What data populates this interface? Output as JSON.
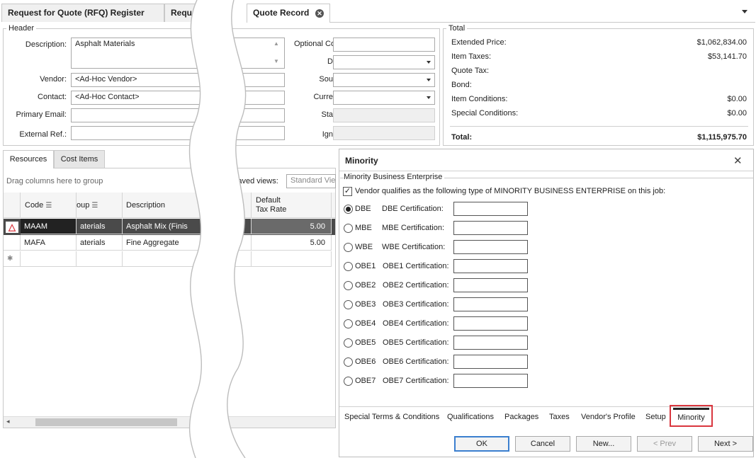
{
  "tabs": [
    {
      "label": "Request for Quote (RFQ) Register"
    },
    {
      "label": "Reque"
    },
    {
      "label": "Quote Record"
    }
  ],
  "header": {
    "section_title": "Header",
    "description_label": "Description:",
    "description_value": "Asphalt Materials",
    "vendor_label": "Vendor:",
    "vendor_value": "<Ad-Hoc Vendor>",
    "contact_label": "Contact:",
    "contact_value": "<Ad-Hoc Contact>",
    "email_label": "Primary Email:",
    "email_value": "",
    "extref_label": "External Ref.:",
    "extref_value": "",
    "optional_label": "Optional Co",
    "d_label": "D",
    "sou_label": "Sou",
    "curr_label": "Curre",
    "sta_label": "Sta",
    "ign_label": "Ign"
  },
  "totals": {
    "section_title": "Total",
    "rows": [
      {
        "label": "Extended Price:",
        "value": "$1,062,834.00"
      },
      {
        "label": "Item Taxes:",
        "value": "$53,141.70"
      },
      {
        "label": "Quote Tax:",
        "value": ""
      },
      {
        "label": "Bond:",
        "value": ""
      },
      {
        "label": "Item Conditions:",
        "value": "$0.00"
      },
      {
        "label": "Special Conditions:",
        "value": "$0.00"
      }
    ],
    "total_label": "Total:",
    "total_value": "$1,115,975.70"
  },
  "grid": {
    "tabs": [
      "Resources",
      "Cost Items"
    ],
    "group_hint": "Drag columns here to group",
    "saved_views_label": "Saved views:",
    "saved_views_value": "Standard Vie",
    "columns": [
      "Code",
      "oup",
      "Description",
      "Default Tax Rate"
    ],
    "default_col_line1": "Default",
    "default_col_line2": "Tax Rate",
    "rows": [
      {
        "code": "MAAM",
        "group": "aterials",
        "description": "Asphalt Mix (Finis",
        "rate": "5.00"
      },
      {
        "code": "MAFA",
        "group": "aterials",
        "description": "Fine Aggregate",
        "rate": "5.00"
      }
    ]
  },
  "dialog": {
    "title": "Minority",
    "group_title": "Minority Business Enterprise",
    "qualifies_text": "Vendor qualifies as the following type of MINORITY BUSINESS ENTERPRISE on this job:",
    "options": [
      {
        "type": "DBE",
        "cert_label": "DBE Certification:",
        "selected": true
      },
      {
        "type": "MBE",
        "cert_label": "MBE Certification:",
        "selected": false
      },
      {
        "type": "WBE",
        "cert_label": "WBE Certification:",
        "selected": false
      },
      {
        "type": "OBE1",
        "cert_label": "OBE1 Certification:",
        "selected": false
      },
      {
        "type": "OBE2",
        "cert_label": "OBE2 Certification:",
        "selected": false
      },
      {
        "type": "OBE3",
        "cert_label": "OBE3 Certification:",
        "selected": false
      },
      {
        "type": "OBE4",
        "cert_label": "OBE4 Certification:",
        "selected": false
      },
      {
        "type": "OBE5",
        "cert_label": "OBE5 Certification:",
        "selected": false
      },
      {
        "type": "OBE6",
        "cert_label": "OBE6 Certification:",
        "selected": false
      },
      {
        "type": "OBE7",
        "cert_label": "OBE7 Certification:",
        "selected": false
      }
    ]
  },
  "bottom_tabs": [
    "Special Terms & Conditions",
    "Qualifications",
    "Packages",
    "Taxes",
    "Vendor's Profile",
    "Setup",
    "Minority"
  ],
  "buttons": {
    "ok": "OK",
    "cancel": "Cancel",
    "new": "New...",
    "prev": "< Prev",
    "next": "Next >"
  },
  "colors": {
    "highlight": "#d9363e",
    "selected_row": "#4a4a4a",
    "accent": "#3b7fcf"
  }
}
